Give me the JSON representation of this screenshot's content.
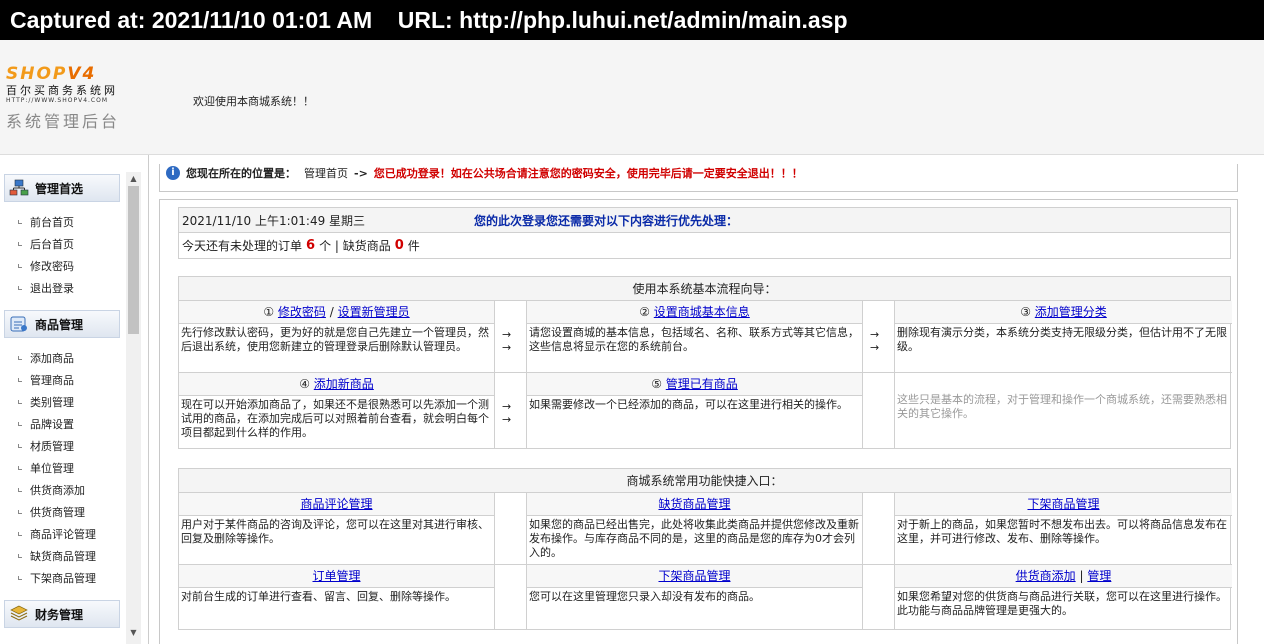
{
  "capture": {
    "text": "Captured at: 2021/11/10 01:01 AM    URL: http://php.luhui.net/admin/main.asp"
  },
  "header": {
    "logo_brand_a": "SHOP",
    "logo_brand_b": "V4",
    "logo_cn": "百尔买商务系统网",
    "logo_url": "HTTP://WWW.SHOPV4.COM",
    "logo_admin": "系统管理后台",
    "welcome": "欢迎使用本商城系统！！"
  },
  "sidebar": {
    "sections": [
      {
        "title": "管理首选",
        "icon": "network-icon",
        "items": [
          "前台首页",
          "后台首页",
          "修改密码",
          "退出登录"
        ]
      },
      {
        "title": "商品管理",
        "icon": "box-icon",
        "items": [
          "添加商品",
          "管理商品",
          "类别管理",
          "品牌设置",
          "材质管理",
          "单位管理",
          "供货商添加",
          "供货商管理",
          "商品评论管理",
          "缺货商品管理",
          "下架商品管理"
        ]
      },
      {
        "title": "财务管理",
        "icon": "money-icon",
        "items": []
      }
    ]
  },
  "location": {
    "label": "您现在所在的位置是：",
    "page": "管理首页",
    "arrow": "->",
    "warning": "您已成功登录！如在公共场合请注意您的密码安全，使用完毕后请一定要安全退出！！！"
  },
  "status": {
    "datetime": "2021/11/10 上午1:01:49 星期三",
    "priority": "您的此次登录您还需要对以下内容进行优先处理：",
    "orders_pre": "今天还有未处理的订单",
    "orders_count": "6",
    "orders_post": "个 | 缺货商品",
    "stock_count": "0",
    "stock_post": "件"
  },
  "flow": {
    "title": "使用本系统基本流程向导：",
    "steps": [
      {
        "num": "①",
        "link1": "修改密码",
        "sep": "/",
        "link2": "设置新管理员",
        "desc": "先行修改默认密码，更为好的就是您自己先建立一个管理员，然后退出系统，使用您新建立的管理登录后删除默认管理员。"
      },
      {
        "num": "②",
        "link1": "设置商城基本信息",
        "desc": "请您设置商城的基本信息，包括域名、名称、联系方式等其它信息，这些信息将显示在您的系统前台。"
      },
      {
        "num": "③",
        "link1": "添加管理分类",
        "desc": "删除现有演示分类，本系统分类支持无限级分类，但估计用不了无限级。"
      },
      {
        "num": "④",
        "link1": "添加新商品",
        "desc": "现在可以开始添加商品了，如果还不是很熟悉可以先添加一个测试用的商品，在添加完成后可以对照着前台查看，就会明白每个项目都起到什么样的作用。"
      },
      {
        "num": "⑤",
        "link1": "管理已有商品",
        "desc": "如果需要修改一个已经添加的商品，可以在这里进行相关的操作。"
      }
    ],
    "note": "这些只是基本的流程，对于管理和操作一个商城系统，还需要熟悉相关的其它操作。",
    "arrow": "→"
  },
  "shortcuts": {
    "title": "商城系统常用功能快捷入口：",
    "items": [
      {
        "link1": "商品评论管理",
        "desc": "用户对于某件商品的咨询及评论，您可以在这里对其进行审核、回复及删除等操作。"
      },
      {
        "link1": "缺货商品管理",
        "desc": "如果您的商品已经出售完，此处将收集此类商品并提供您修改及重新发布操作。与库存商品不同的是，这里的商品是您的库存为0才会列入的。"
      },
      {
        "link1": "下架商品管理",
        "desc": "对于新上的商品，如果您暂时不想发布出去。可以将商品信息发布在这里，并可进行修改、发布、删除等操作。"
      },
      {
        "link1": "订单管理",
        "desc": "对前台生成的订单进行查看、留言、回复、删除等操作。"
      },
      {
        "link1": "下架商品管理",
        "desc": "您可以在这里管理您只录入却没有发布的商品。"
      },
      {
        "link1": "供货商添加",
        "sep": "|",
        "link2": "管理",
        "desc": "如果您希望对您的供货商与商品进行关联，您可以在这里进行操作。此功能与商品品牌管理是更强大的。"
      }
    ]
  }
}
